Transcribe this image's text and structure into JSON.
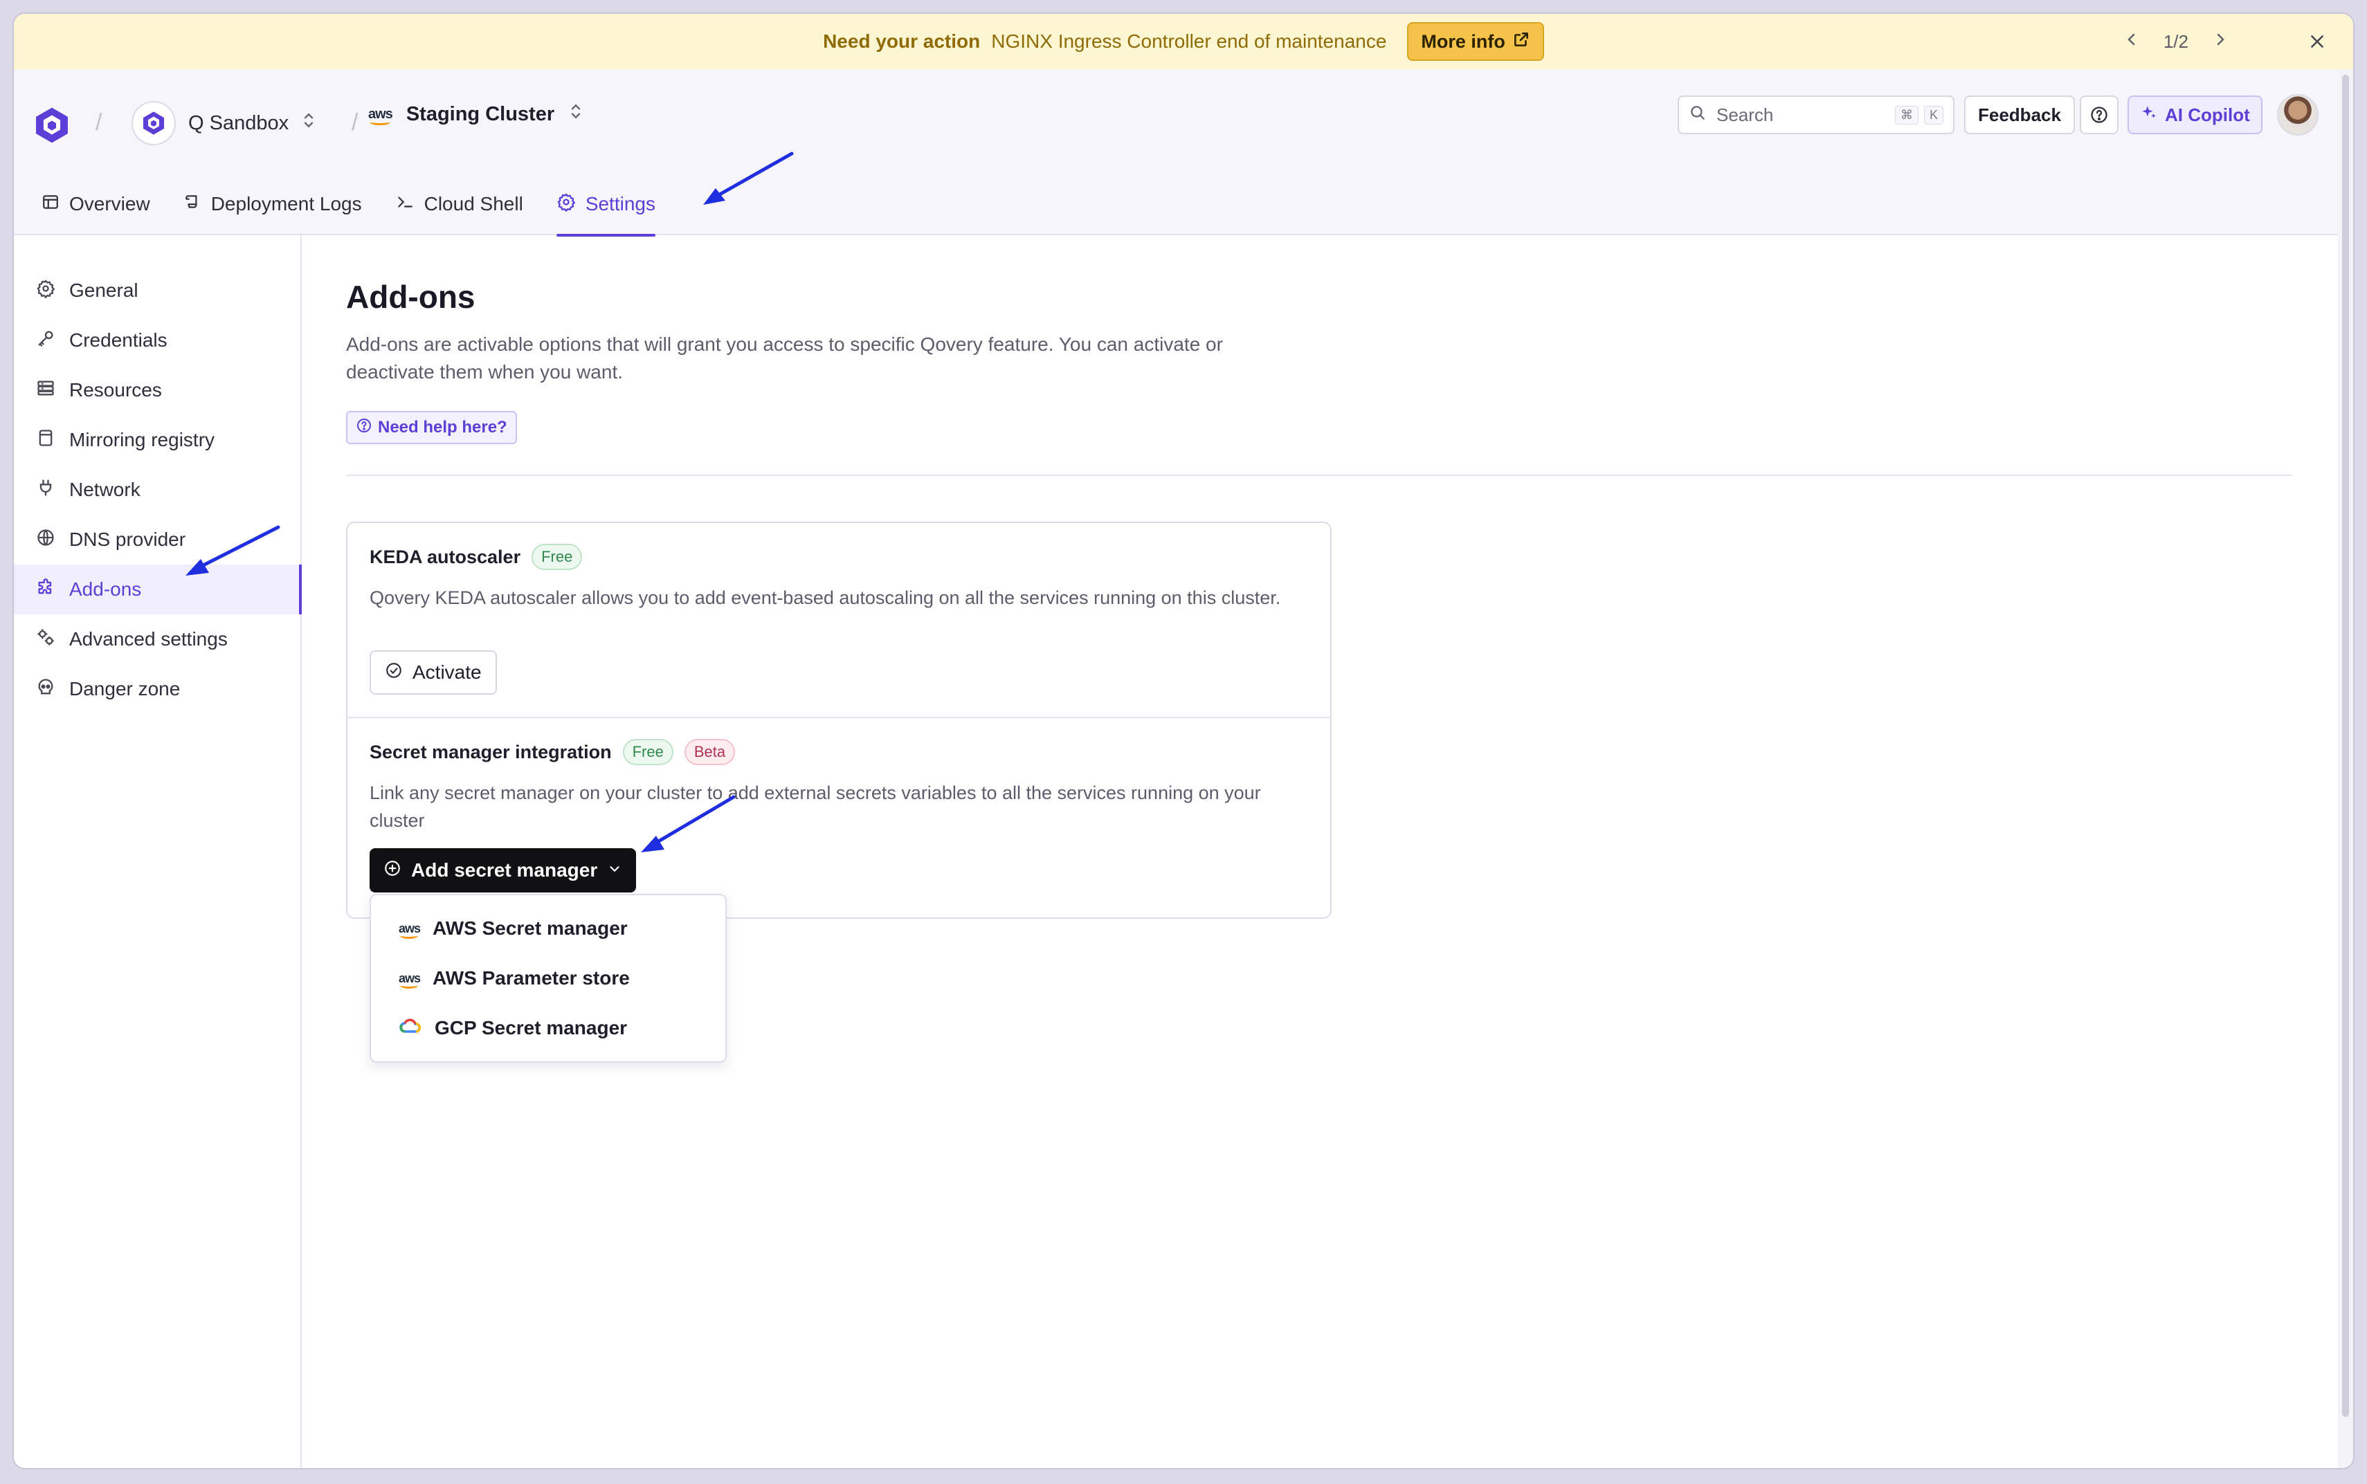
{
  "banner": {
    "need_label": "Need your action",
    "message": "NGINX Ingress Controller end of maintenance",
    "more_info_label": "More info",
    "pager": "1/2"
  },
  "header": {
    "org_name": "Q Sandbox",
    "cluster_name": "Staging Cluster",
    "aws_badge": "aws",
    "search_placeholder": "Search",
    "search_kbd_1": "⌘",
    "search_kbd_2": "K",
    "feedback_label": "Feedback",
    "copilot_label": "AI Copilot"
  },
  "tabs": [
    {
      "label": "Overview"
    },
    {
      "label": "Deployment Logs"
    },
    {
      "label": "Cloud Shell"
    },
    {
      "label": "Settings"
    }
  ],
  "sidebar": {
    "items": [
      {
        "label": "General"
      },
      {
        "label": "Credentials"
      },
      {
        "label": "Resources"
      },
      {
        "label": "Mirroring registry"
      },
      {
        "label": "Network"
      },
      {
        "label": "DNS provider"
      },
      {
        "label": "Add-ons"
      },
      {
        "label": "Advanced settings"
      },
      {
        "label": "Danger zone"
      }
    ]
  },
  "main": {
    "title": "Add-ons",
    "description": "Add-ons are activable options that will grant you access to specific Qovery feature. You can activate or deactivate them when you want.",
    "help_link": "Need help here?"
  },
  "addons": {
    "keda": {
      "title": "KEDA autoscaler",
      "badge": "Free",
      "description": "Qovery KEDA autoscaler allows you to add event-based autoscaling on all the services running on this cluster.",
      "button": "Activate"
    },
    "secret": {
      "title": "Secret manager integration",
      "badge_free": "Free",
      "badge_beta": "Beta",
      "description": "Link any secret manager on your cluster to add external secrets variables to all the services running on your cluster",
      "button": "Add secret manager"
    }
  },
  "dropdown": {
    "items": [
      {
        "label": "AWS Secret manager",
        "icon": "aws"
      },
      {
        "label": "AWS Parameter store",
        "icon": "aws"
      },
      {
        "label": "GCP Secret manager",
        "icon": "gcp"
      }
    ]
  },
  "colors": {
    "accent": "#5b3fd6",
    "banner_bg": "#fdf6d3",
    "annotation_arrow": "#1f2fe0"
  }
}
